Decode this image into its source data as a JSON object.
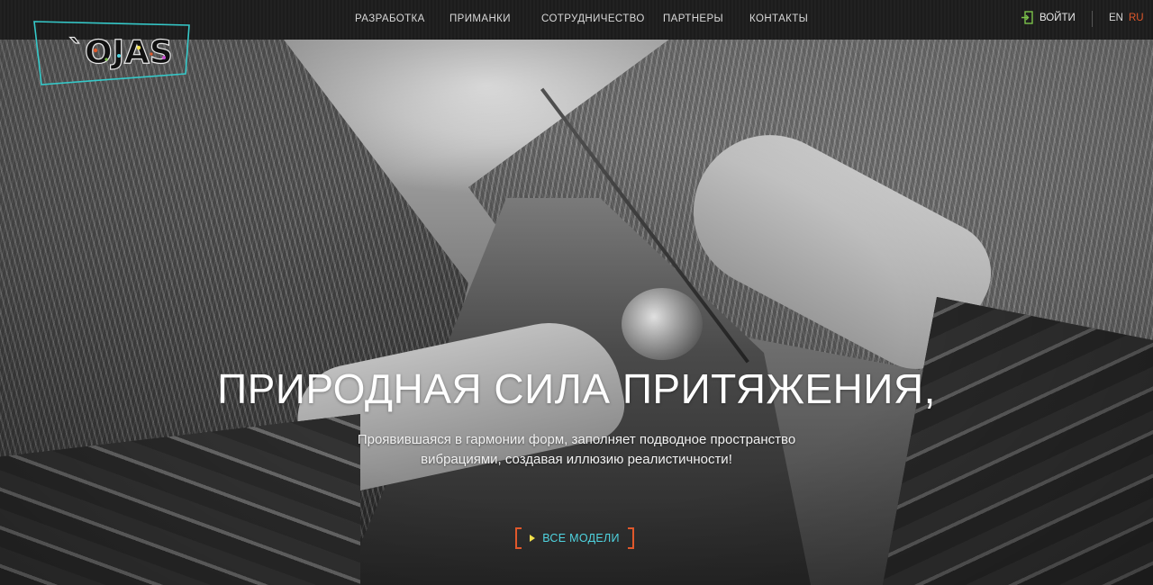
{
  "brand": {
    "logo_text": "`OJAS"
  },
  "nav": {
    "items": [
      {
        "label": "РАЗРАБОТКА"
      },
      {
        "label": "ПРИМАНКИ"
      },
      {
        "label": "СОТРУДНИЧЕСТВО"
      },
      {
        "label": "ПАРТНЕРЫ"
      },
      {
        "label": "КОНТАКТЫ"
      }
    ],
    "login_label": "ВОЙТИ",
    "languages": [
      {
        "code": "EN",
        "active": false
      },
      {
        "code": "RU",
        "active": true
      }
    ]
  },
  "hero": {
    "headline": "ПРИРОДНАЯ СИЛА ПРИТЯЖЕНИЯ,",
    "subtext_line1": "Проявившаяся в гармонии форм, заполняет подводное пространство",
    "subtext_line2": "вибрациями, создавая иллюзию реалистичности!",
    "cta_label": "ВСЕ МОДЕЛИ"
  },
  "colors": {
    "accent_orange": "#e0582b",
    "accent_cyan": "#4fd4e0",
    "accent_yellow": "#f2e04a",
    "login_icon_green": "#7cc24a",
    "lang_active": "#e0582b",
    "topbar_bg": "#1d1d1d"
  },
  "icons": {
    "login": "login-icon",
    "cta_arrow": "play-arrow-icon"
  }
}
